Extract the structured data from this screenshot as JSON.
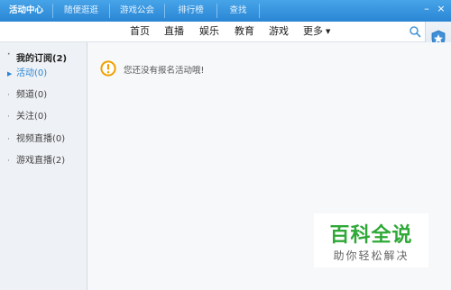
{
  "title_tabs": [
    {
      "label": "活动中心"
    },
    {
      "label": "随便逛逛"
    },
    {
      "label": "游戏公会"
    },
    {
      "label": "排行榜"
    },
    {
      "label": "查找"
    }
  ],
  "window_controls": {
    "minimize": "–",
    "close": "×"
  },
  "nav": {
    "items": [
      {
        "label": "首页"
      },
      {
        "label": "直播"
      },
      {
        "label": "娱乐"
      },
      {
        "label": "教育"
      },
      {
        "label": "游戏"
      },
      {
        "label": "更多"
      }
    ],
    "more_arrow": "▼"
  },
  "sidebar": {
    "header": "我的订阅(2)",
    "items": [
      {
        "label": "活动(0)"
      },
      {
        "label": "频道(0)"
      },
      {
        "label": "关注(0)"
      },
      {
        "label": "视频直播(0)"
      },
      {
        "label": "游戏直播(2)"
      }
    ]
  },
  "main": {
    "notice": "您还没有报名活动哦!"
  },
  "watermark": {
    "main": "百科全说",
    "sub": "助你轻松解决"
  },
  "colors": {
    "title_bar": "#2a86d4",
    "accent": "#2a86d4",
    "notice_icon": "#f0a000",
    "watermark_green": "#2ea836"
  }
}
